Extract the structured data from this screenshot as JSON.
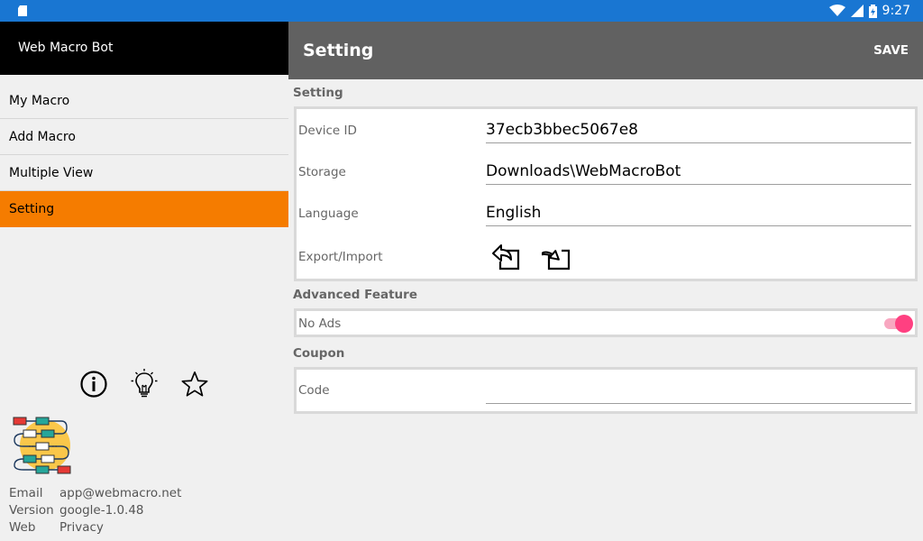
{
  "statusbar": {
    "time": "9:27"
  },
  "drawer": {
    "title": "Web Macro Bot",
    "menu": [
      {
        "label": "My Macro"
      },
      {
        "label": "Add Macro"
      },
      {
        "label": "Multiple View"
      },
      {
        "label": "Setting",
        "active": true
      }
    ],
    "icons": [
      "info-icon",
      "lightbulb-icon",
      "star-icon"
    ],
    "info": {
      "email_label": "Email",
      "email_value": "app@webmacro.net",
      "version_label": "Version",
      "version_value": "google-1.0.48",
      "web_label": "Web",
      "web_value": "Privacy"
    }
  },
  "appbar": {
    "title": "Setting",
    "save_label": "SAVE"
  },
  "settings": {
    "section_label": "Setting",
    "device_id_label": "Device ID",
    "device_id_value": "37ecb3bbec5067e8",
    "storage_label": "Storage",
    "storage_value": "Downloads\\WebMacroBot",
    "language_label": "Language",
    "language_value": "English",
    "export_import_label": "Export/Import"
  },
  "advanced": {
    "section_label": "Advanced Feature",
    "no_ads_label": "No Ads",
    "no_ads_enabled": true
  },
  "coupon": {
    "section_label": "Coupon",
    "code_label": "Code",
    "code_value": ""
  },
  "colors": {
    "accent": "#f57c00",
    "statusbar": "#1976d2",
    "appbar": "#616161",
    "toggle": "#ff4081"
  }
}
